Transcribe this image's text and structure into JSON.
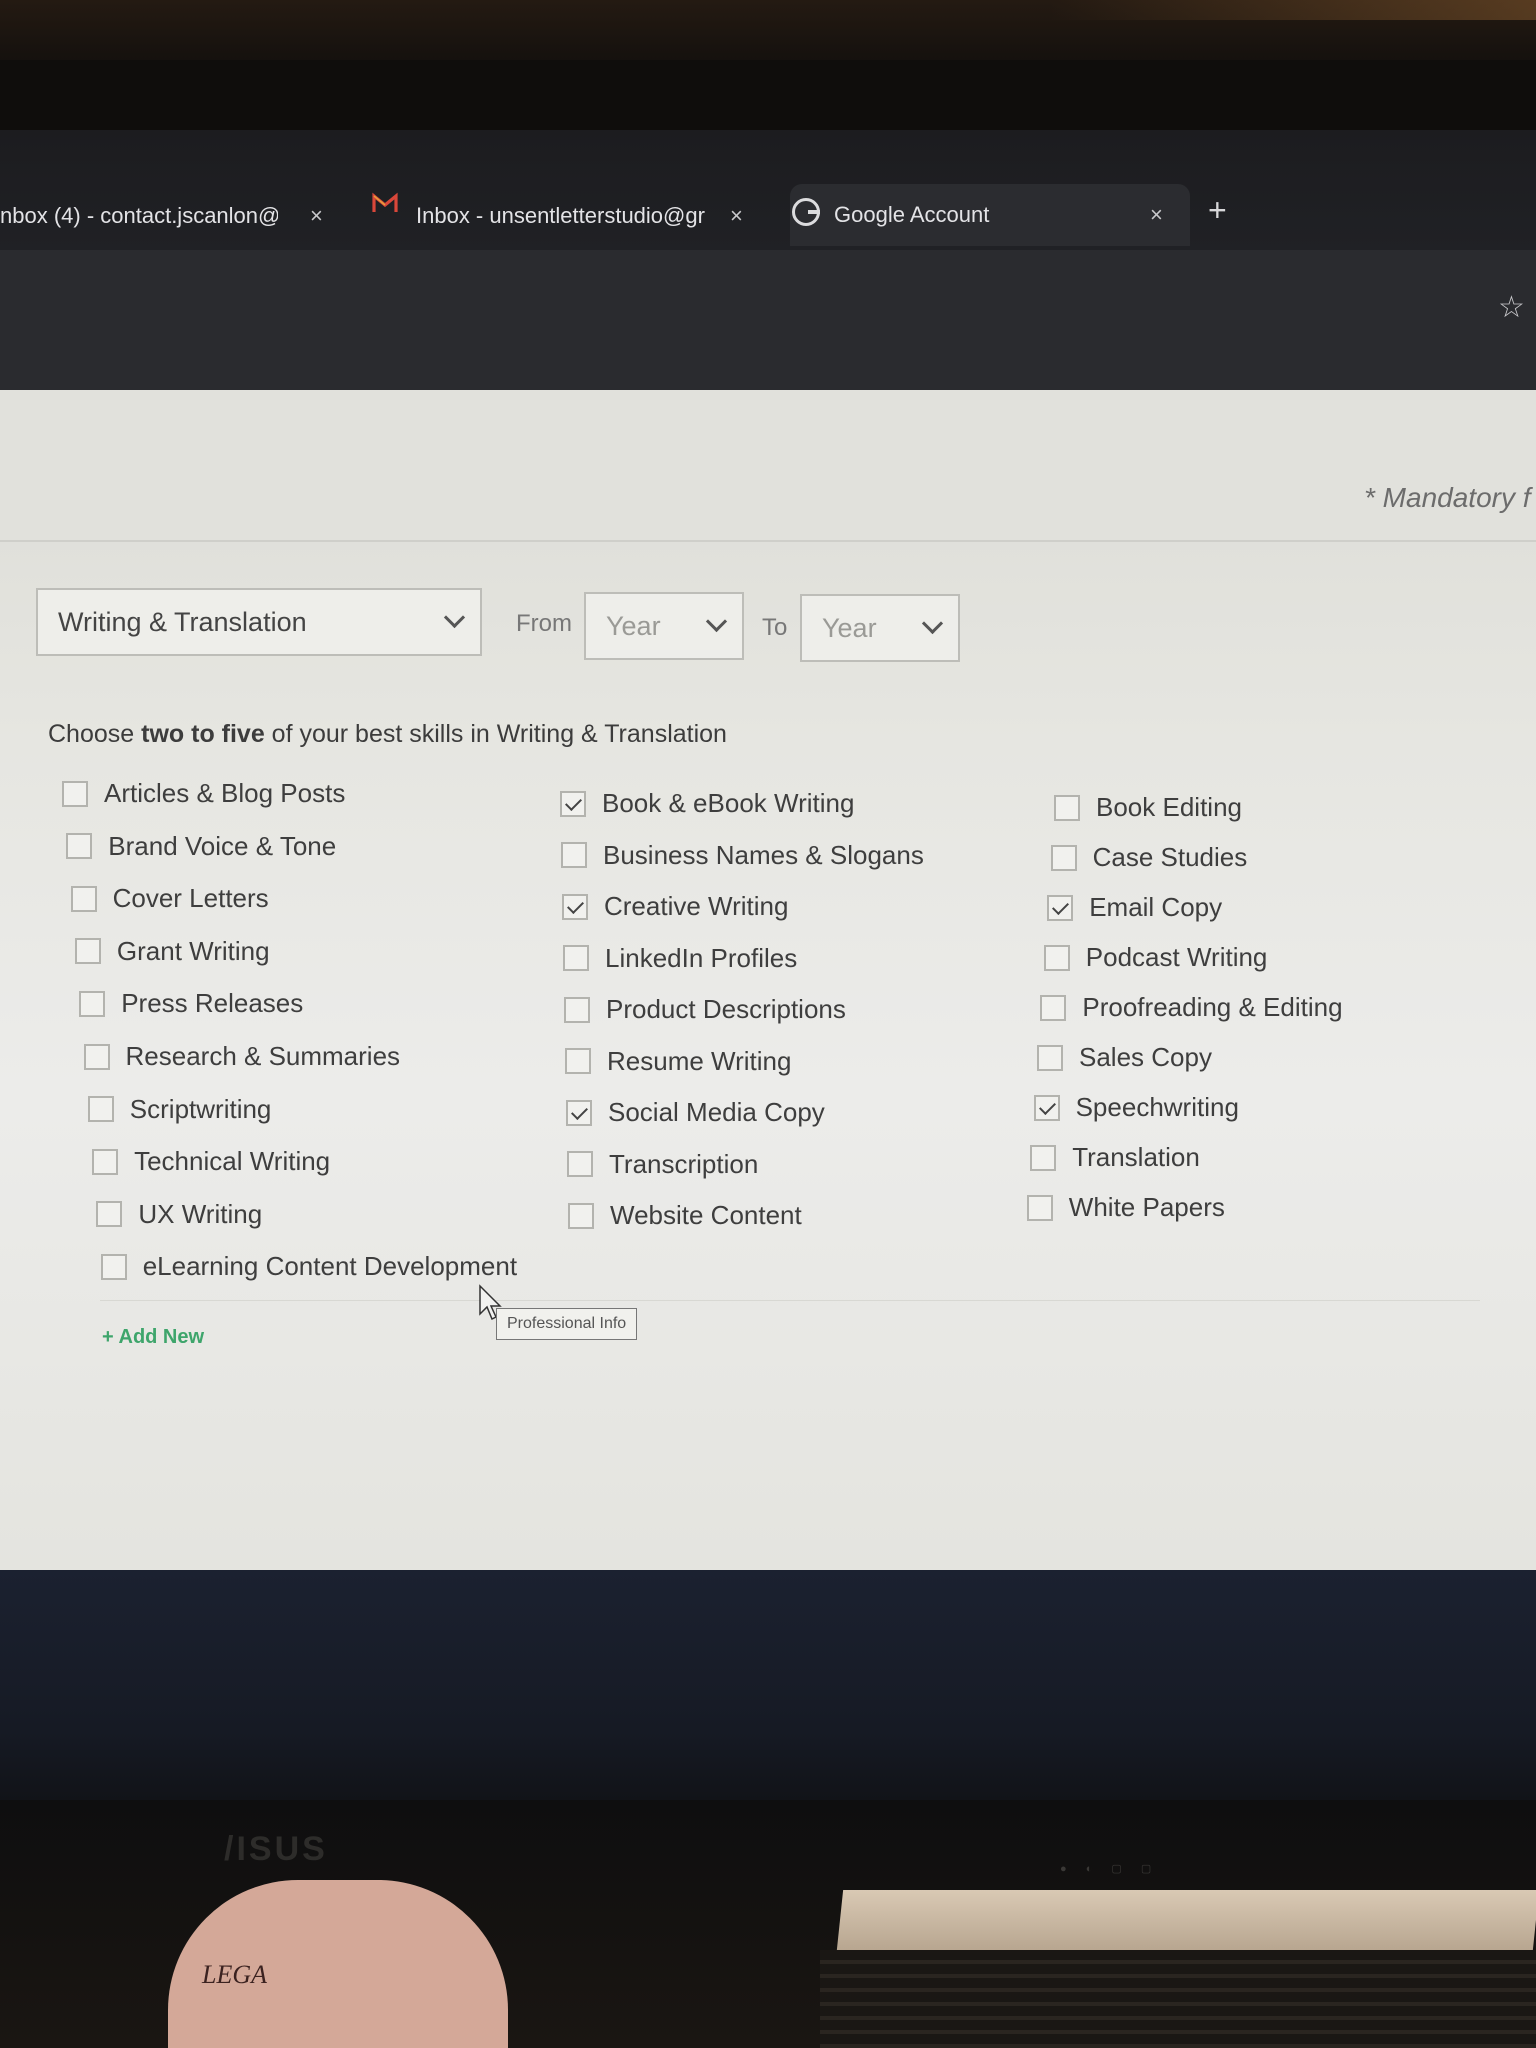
{
  "browser": {
    "tabs": [
      {
        "title": "nbox (4) - contact.jscanlon@g",
        "close": "×"
      },
      {
        "title": "Inbox - unsentletterstudio@gr",
        "close": "×"
      },
      {
        "title": "Google Account",
        "close": "×"
      }
    ],
    "new_tab": "+",
    "bookmark_icon": "☆"
  },
  "page": {
    "mandatory_note": "* Mandatory f",
    "category_select": {
      "value": "Writing & Translation"
    },
    "from_label": "From",
    "from_year": {
      "placeholder": "Year"
    },
    "to_label": "To",
    "to_year": {
      "placeholder": "Year"
    },
    "instruction": {
      "prefix": "Choose ",
      "emphasis": "two to five",
      "suffix": " of your best skills in Writing & Translation"
    },
    "skills_col1": [
      {
        "label": "Articles & Blog Posts",
        "checked": false
      },
      {
        "label": "Brand Voice & Tone",
        "checked": false
      },
      {
        "label": "Cover Letters",
        "checked": false
      },
      {
        "label": "Grant Writing",
        "checked": false
      },
      {
        "label": "Press Releases",
        "checked": false
      },
      {
        "label": "Research & Summaries",
        "checked": false
      },
      {
        "label": "Scriptwriting",
        "checked": false
      },
      {
        "label": "Technical Writing",
        "checked": false
      },
      {
        "label": "UX Writing",
        "checked": false
      },
      {
        "label": "eLearning Content Development",
        "checked": false
      }
    ],
    "skills_col2": [
      {
        "label": "Book & eBook Writing",
        "checked": true
      },
      {
        "label": "Business Names & Slogans",
        "checked": false
      },
      {
        "label": "Creative Writing",
        "checked": true
      },
      {
        "label": "LinkedIn Profiles",
        "checked": false
      },
      {
        "label": "Product Descriptions",
        "checked": false
      },
      {
        "label": "Resume Writing",
        "checked": false
      },
      {
        "label": "Social Media Copy",
        "checked": true
      },
      {
        "label": "Transcription",
        "checked": false
      },
      {
        "label": "Website Content",
        "checked": false
      }
    ],
    "skills_col3": [
      {
        "label": "Book Editing",
        "checked": false
      },
      {
        "label": "Case Studies",
        "checked": false
      },
      {
        "label": "Email Copy",
        "checked": true
      },
      {
        "label": "Podcast Writing",
        "checked": false
      },
      {
        "label": "Proofreading & Editing",
        "checked": false
      },
      {
        "label": "Sales Copy",
        "checked": false
      },
      {
        "label": "Speechwriting",
        "checked": true
      },
      {
        "label": "Translation",
        "checked": false
      },
      {
        "label": "White Papers",
        "checked": false
      }
    ],
    "add_new": "+ Add New",
    "tooltip": "Professional Info"
  },
  "surroundings": {
    "monitor_brand": "/ISUS",
    "book_text": "LEGA"
  },
  "colors": {
    "accent_green": "#3ea56b",
    "tab_bar": "#202125",
    "page_bg": "#e6e6e1"
  }
}
